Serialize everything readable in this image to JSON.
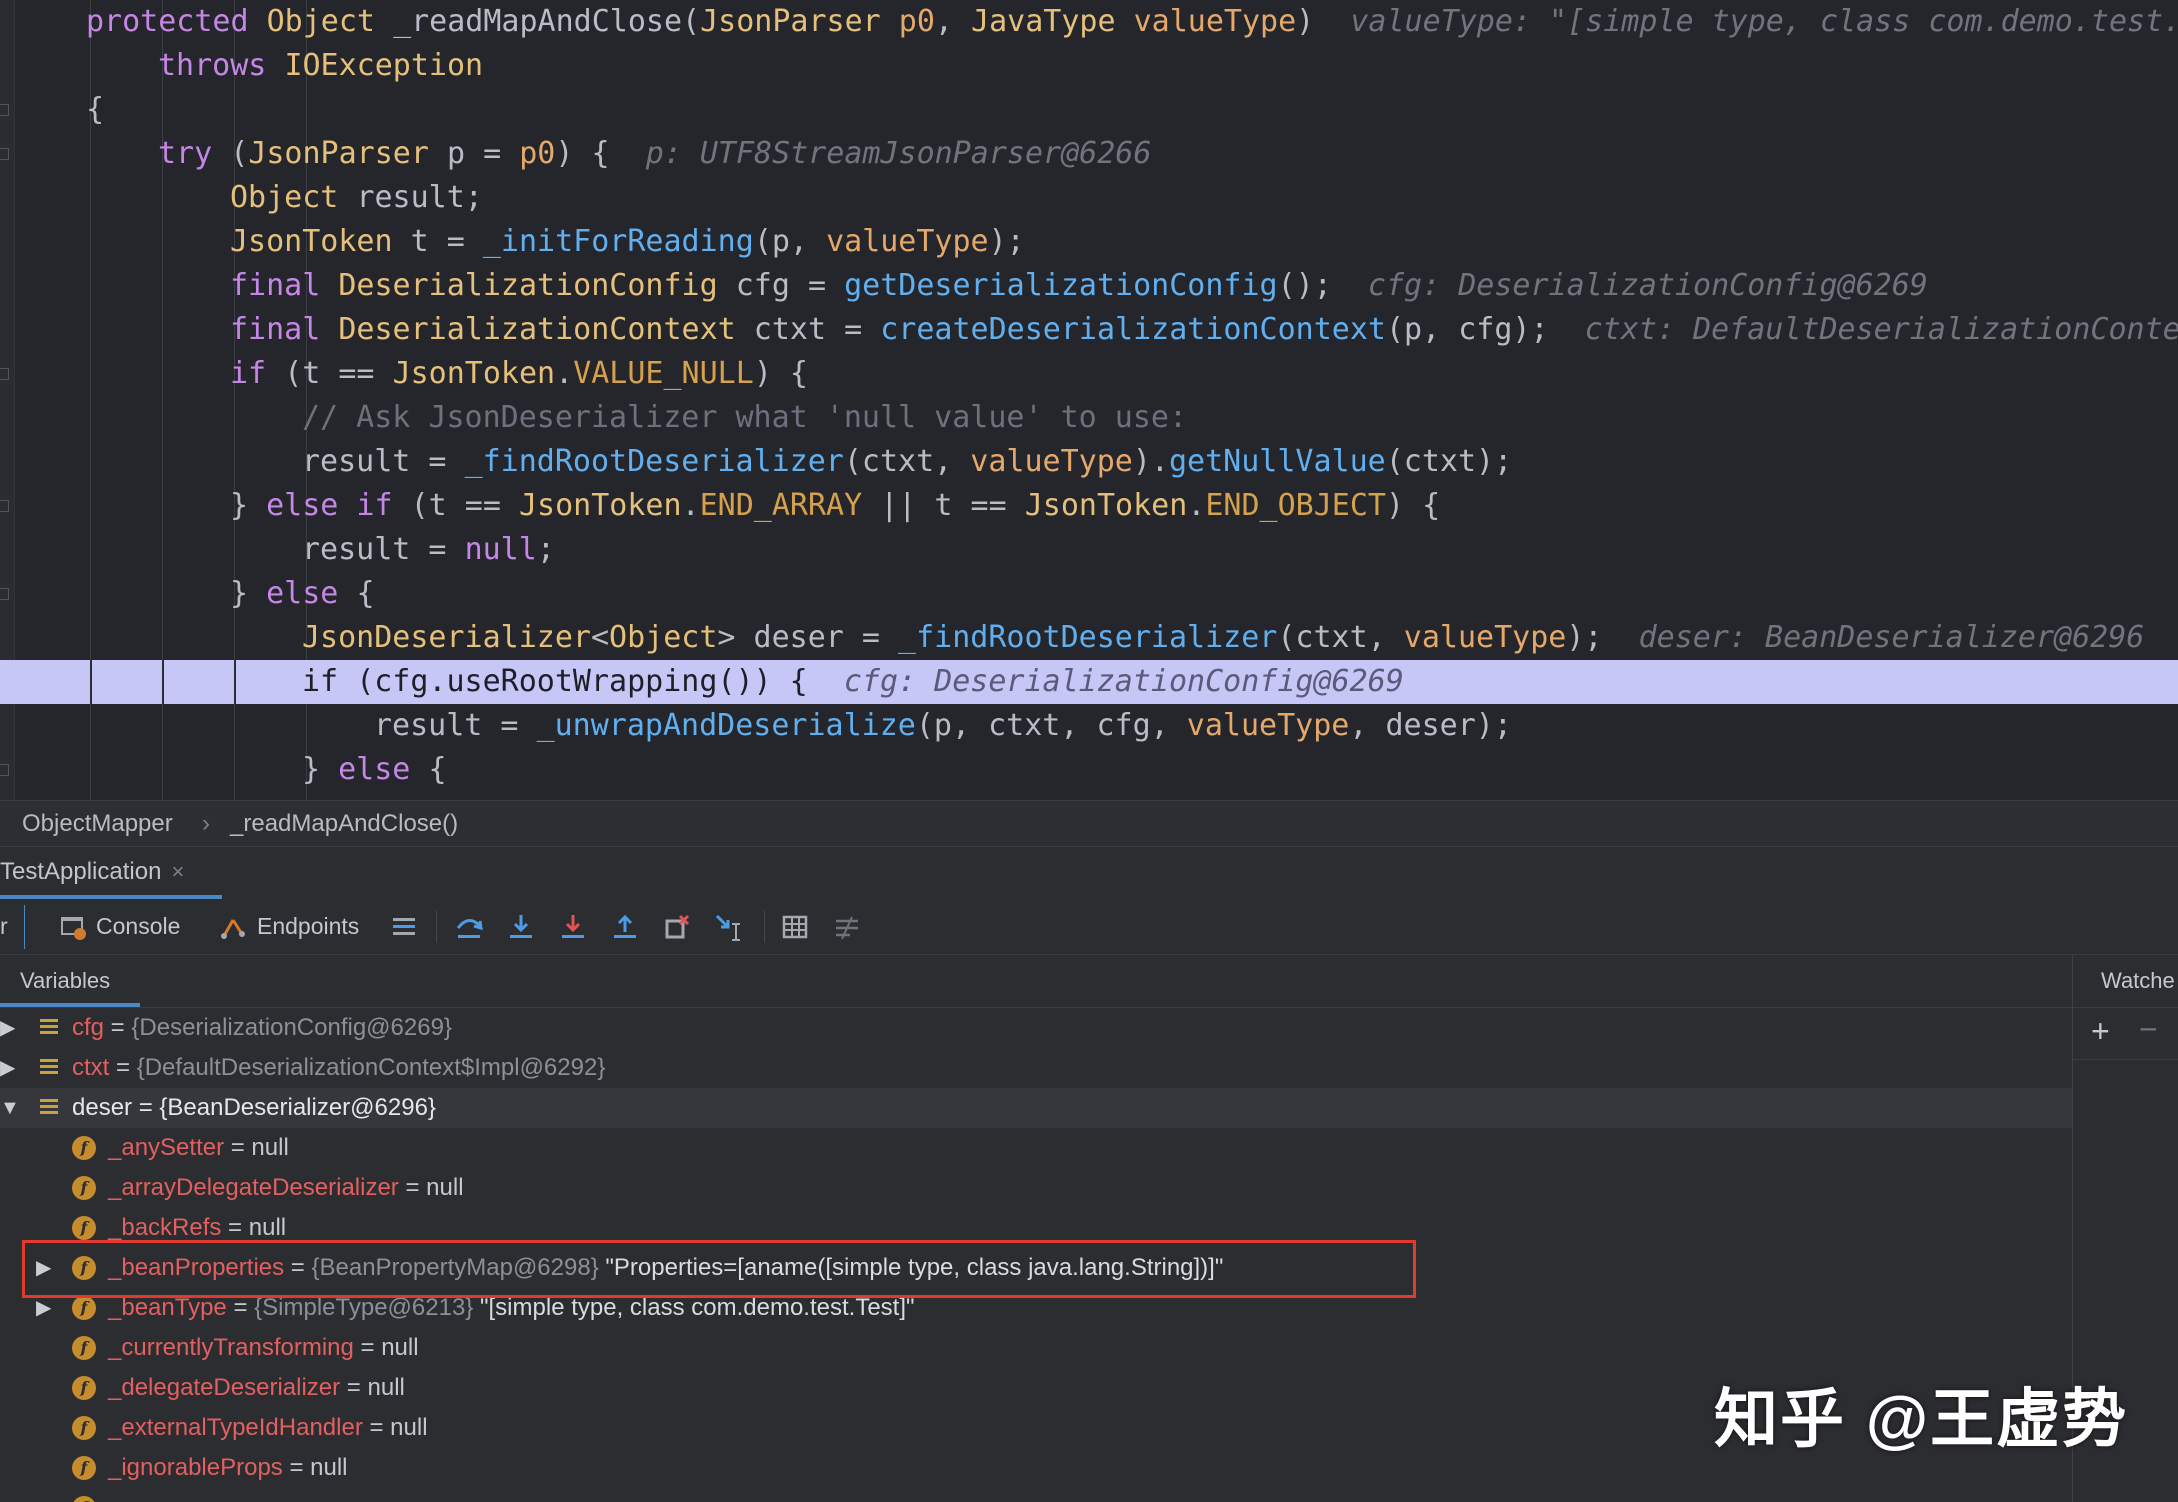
{
  "editor": {
    "lines": [
      {
        "segs": [
          [
            "kw",
            "protected "
          ],
          [
            "ty",
            "Object "
          ],
          [
            "pu",
            "_readMapAndClose("
          ],
          [
            "ty",
            "JsonParser "
          ],
          [
            "pa",
            "p0"
          ],
          [
            "pu",
            ", "
          ],
          [
            "ty",
            "JavaType "
          ],
          [
            "pa",
            "valueType"
          ],
          [
            "pu",
            ")  "
          ],
          [
            "ph",
            "valueType: \"[simple type, class com.demo.test."
          ]
        ]
      },
      {
        "segs": [
          [
            "kw",
            "throws "
          ],
          [
            "ty",
            "IOException"
          ]
        ]
      },
      {
        "segs": [
          [
            "pu",
            "{"
          ]
        ]
      },
      {
        "segs": [
          [
            "kw",
            "try "
          ],
          [
            "pu",
            "("
          ],
          [
            "ty",
            "JsonParser "
          ],
          [
            "pu",
            "p = "
          ],
          [
            "pa",
            "p0"
          ],
          [
            "pu",
            ") {  "
          ],
          [
            "ph",
            "p: UTF8StreamJsonParser@6266"
          ]
        ]
      },
      {
        "segs": [
          [
            "ty",
            "Object "
          ],
          [
            "pu",
            "result;"
          ]
        ]
      },
      {
        "segs": [
          [
            "ty",
            "JsonToken "
          ],
          [
            "pu",
            "t = "
          ],
          [
            "fn",
            "_initForReading"
          ],
          [
            "pu",
            "(p, "
          ],
          [
            "pa",
            "valueType"
          ],
          [
            "pu",
            ");"
          ]
        ]
      },
      {
        "segs": [
          [
            "kw",
            "final "
          ],
          [
            "ty",
            "DeserializationConfig "
          ],
          [
            "pu",
            "cfg = "
          ],
          [
            "fn",
            "getDeserializationConfig"
          ],
          [
            "pu",
            "();  "
          ],
          [
            "ph",
            "cfg: DeserializationConfig@6269"
          ]
        ]
      },
      {
        "segs": [
          [
            "kw",
            "final "
          ],
          [
            "ty",
            "DeserializationContext "
          ],
          [
            "pu",
            "ctxt = "
          ],
          [
            "fn",
            "createDeserializationContext"
          ],
          [
            "pu",
            "(p, cfg);  "
          ],
          [
            "ph",
            "ctxt: DefaultDeserializationConte"
          ]
        ]
      },
      {
        "segs": [
          [
            "kw",
            "if "
          ],
          [
            "pu",
            "(t == "
          ],
          [
            "ty",
            "JsonToken"
          ],
          [
            "pu",
            "."
          ],
          [
            "cn",
            "VALUE_NULL"
          ],
          [
            "pu",
            ") {"
          ]
        ]
      },
      {
        "segs": [
          [
            "cm",
            "// Ask JsonDeserializer what 'null value' to use:"
          ]
        ]
      },
      {
        "segs": [
          [
            "pu",
            "result = "
          ],
          [
            "fn",
            "_findRootDeserializer"
          ],
          [
            "pu",
            "(ctxt, "
          ],
          [
            "pa",
            "valueType"
          ],
          [
            "pu",
            ")."
          ],
          [
            "fn",
            "getNullValue"
          ],
          [
            "pu",
            "(ctxt);"
          ]
        ]
      },
      {
        "segs": [
          [
            "pu",
            "} "
          ],
          [
            "kw",
            "else if "
          ],
          [
            "pu",
            "(t == "
          ],
          [
            "ty",
            "JsonToken"
          ],
          [
            "pu",
            "."
          ],
          [
            "cn",
            "END_ARRAY"
          ],
          [
            "pu",
            " || t == "
          ],
          [
            "ty",
            "JsonToken"
          ],
          [
            "pu",
            "."
          ],
          [
            "cn",
            "END_OBJECT"
          ],
          [
            "pu",
            ") {"
          ]
        ]
      },
      {
        "segs": [
          [
            "pu",
            "result = "
          ],
          [
            "kw",
            "null"
          ],
          [
            "pu",
            ";"
          ]
        ]
      },
      {
        "segs": [
          [
            "pu",
            "} "
          ],
          [
            "kw",
            "else "
          ],
          [
            "pu",
            "{"
          ]
        ]
      },
      {
        "segs": [
          [
            "ty",
            "JsonDeserializer"
          ],
          [
            "pu",
            "<"
          ],
          [
            "ty",
            "Object"
          ],
          [
            "pu",
            "> deser = "
          ],
          [
            "fn",
            "_findRootDeserializer"
          ],
          [
            "pu",
            "(ctxt, "
          ],
          [
            "pa",
            "valueType"
          ],
          [
            "pu",
            ");  "
          ],
          [
            "ph",
            "deser: BeanDeserializer@6296"
          ]
        ]
      },
      {
        "segs": [
          [
            "kw",
            "if "
          ],
          [
            "pu",
            "(cfg.useRootWrapping()) {  "
          ],
          [
            "ph",
            "cfg: DeserializationConfig@6269"
          ]
        ]
      },
      {
        "segs": [
          [
            "pu",
            "result = "
          ],
          [
            "fn",
            "_unwrapAndDeserialize"
          ],
          [
            "pu",
            "(p, ctxt, cfg, "
          ],
          [
            "pa",
            "valueType"
          ],
          [
            "pu",
            ", deser);"
          ]
        ]
      },
      {
        "segs": [
          [
            "pu",
            "} "
          ],
          [
            "kw",
            "else "
          ],
          [
            "pu",
            "{"
          ]
        ]
      }
    ]
  },
  "breadcrumb": {
    "class_name": "ObjectMapper",
    "separator": "›",
    "method_name": "_readMapAndClose()"
  },
  "run_tab": {
    "label": "TestApplication",
    "close": "×"
  },
  "toolbar": {
    "left_fragment": "r",
    "console_label": "Console",
    "endpoints_label": "Endpoints"
  },
  "variables": {
    "header": "Variables",
    "rows": [
      {
        "name": "cfg",
        "rest": " = ",
        "ref": "{DeserializationConfig@6269}",
        "str": ""
      },
      {
        "name": "ctxt",
        "rest": " = ",
        "ref": "{DefaultDeserializationContext$Impl@6292}",
        "str": ""
      },
      {
        "name": "deser",
        "rest": " = ",
        "ref": "{BeanDeserializer@6296}",
        "str": ""
      },
      {
        "name": "_anySetter",
        "rest": " = null",
        "ref": "",
        "str": ""
      },
      {
        "name": "_arrayDelegateDeserializer",
        "rest": " = null",
        "ref": "",
        "str": ""
      },
      {
        "name": "_backRefs",
        "rest": " = null",
        "ref": "",
        "str": ""
      },
      {
        "name": "_beanProperties",
        "rest": " = ",
        "ref": "{BeanPropertyMap@6298}",
        "str": " \"Properties=[aname([simple type, class java.lang.String])]\""
      },
      {
        "name": "_beanType",
        "rest": " = ",
        "ref": "{SimpleType@6213}",
        "str": " \"[simple type, class com.demo.test.Test]\""
      },
      {
        "name": "_currentlyTransforming",
        "rest": " = null",
        "ref": "",
        "str": ""
      },
      {
        "name": "_delegateDeserializer",
        "rest": " = null",
        "ref": "",
        "str": ""
      },
      {
        "name": "_externalTypeIdHandler",
        "rest": " = null",
        "ref": "",
        "str": ""
      },
      {
        "name": "_ignorableProps",
        "rest": " = null",
        "ref": "",
        "str": ""
      }
    ]
  },
  "watches": {
    "header": "Watche",
    "add": "+",
    "remove": "−"
  },
  "watermark": "知乎 @王虚势",
  "colors": {
    "editor_bg": "#24262c",
    "highlight_line": "#c7c7f7",
    "keyword": "#c686e6",
    "type": "#e5c07b",
    "function": "#61afef",
    "field_name": "#e2605f",
    "accent_blue": "#4a88c7",
    "red_box": "#e03b2e"
  }
}
